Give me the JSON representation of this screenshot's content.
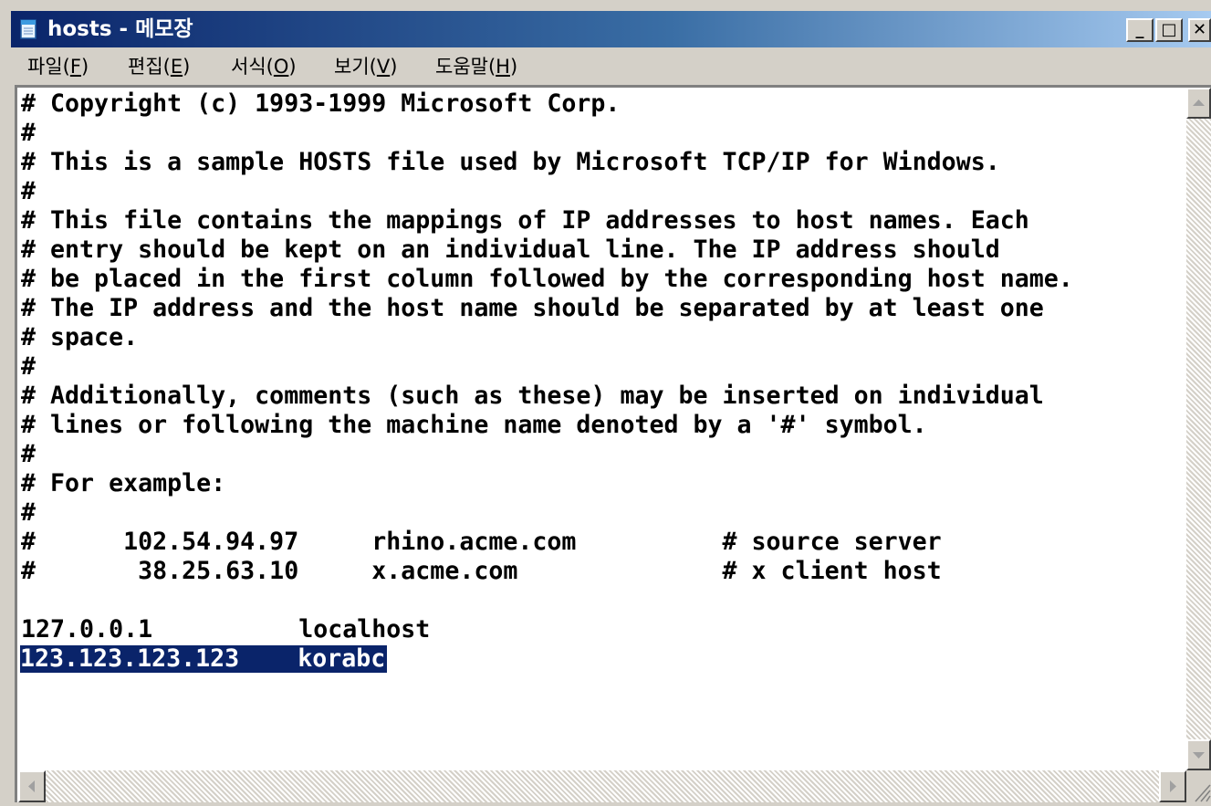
{
  "window": {
    "title": "hosts - 메모장",
    "minimize_glyph": "_",
    "maximize_glyph": "□",
    "close_glyph": "✕",
    "title_gradient": [
      "#0a246a",
      "#a6caf0"
    ],
    "app_icon": "notepad-icon"
  },
  "menu": {
    "items": [
      {
        "label": "파일(",
        "accel": "F",
        "end": ")"
      },
      {
        "label": "편집(",
        "accel": "E",
        "end": ")"
      },
      {
        "label": "서식(",
        "accel": "O",
        "end": ")"
      },
      {
        "label": "보기(",
        "accel": "V",
        "end": ")"
      },
      {
        "label": "도움말(",
        "accel": "H",
        "end": ")"
      }
    ]
  },
  "editor": {
    "lines": [
      "# Copyright (c) 1993-1999 Microsoft Corp.",
      "#",
      "# This is a sample HOSTS file used by Microsoft TCP/IP for Windows.",
      "#",
      "# This file contains the mappings of IP addresses to host names. Each",
      "# entry should be kept on an individual line. The IP address should",
      "# be placed in the first column followed by the corresponding host name.",
      "# The IP address and the host name should be separated by at least one",
      "# space.",
      "#",
      "# Additionally, comments (such as these) may be inserted on individual",
      "# lines or following the machine name denoted by a '#' symbol.",
      "#",
      "# For example:",
      "#",
      "#      102.54.94.97     rhino.acme.com          # source server",
      "#       38.25.63.10     x.acme.com              # x client host",
      "",
      "127.0.0.1          localhost"
    ],
    "selected_line": "123.123.123.123    korabc",
    "selection_color": "#0a246a"
  },
  "scrollbars": {
    "up_icon": "scroll-up-arrow-icon",
    "down_icon": "scroll-down-arrow-icon",
    "left_icon": "scroll-left-arrow-icon",
    "right_icon": "scroll-right-arrow-icon",
    "size_grip_icon": "size-grip-icon"
  }
}
